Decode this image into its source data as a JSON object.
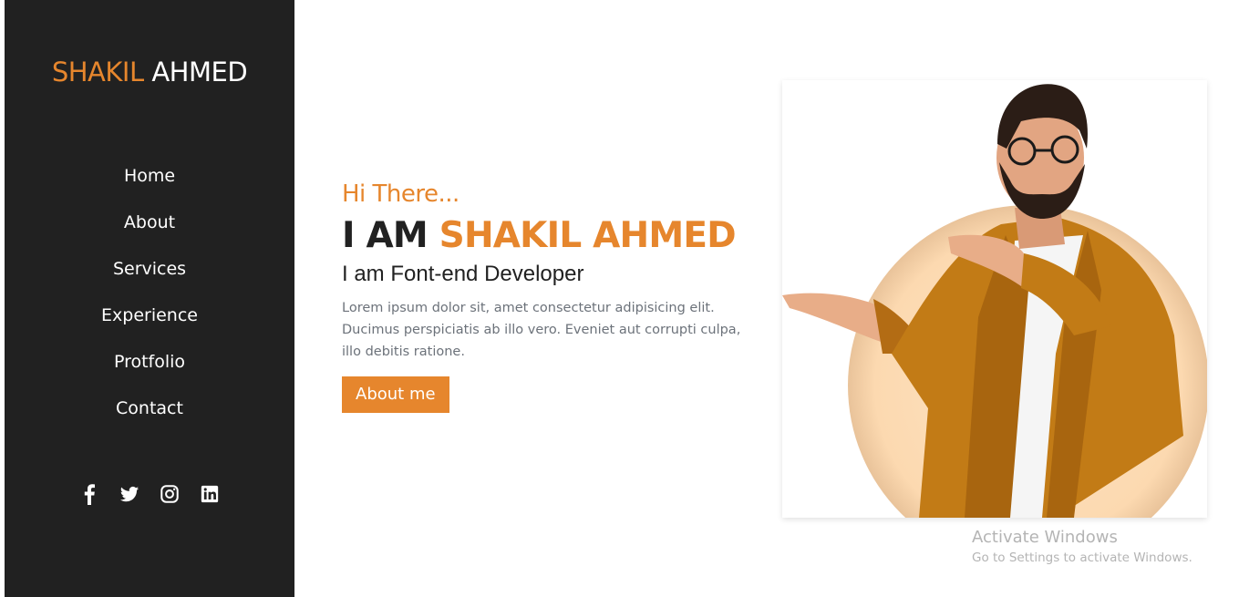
{
  "brand": {
    "first": "SHAKIL",
    "last": "AHMED"
  },
  "nav": [
    "Home",
    "About",
    "Services",
    "Experience",
    "Protfolio",
    "Contact"
  ],
  "social": [
    "facebook-icon",
    "twitter-icon",
    "instagram-icon",
    "linkedin-icon"
  ],
  "hero": {
    "greeting": "Hi There...",
    "intro": "I AM",
    "name": "SHAKIL AHMED",
    "role": "I am Font-end Developer",
    "description": "Lorem ipsum dolor sit, amet consectetur adipisicing elit. Ducimus perspiciatis ab illo vero. Eveniet aut corrupti culpa, illo debitis ratione.",
    "button": "About me"
  },
  "watermark": {
    "title": "Activate Windows",
    "subtitle": "Go to Settings to activate Windows."
  },
  "colors": {
    "accent": "#e6862d",
    "sidebar": "#212121",
    "text": "#212121",
    "muted": "#6c727a"
  }
}
